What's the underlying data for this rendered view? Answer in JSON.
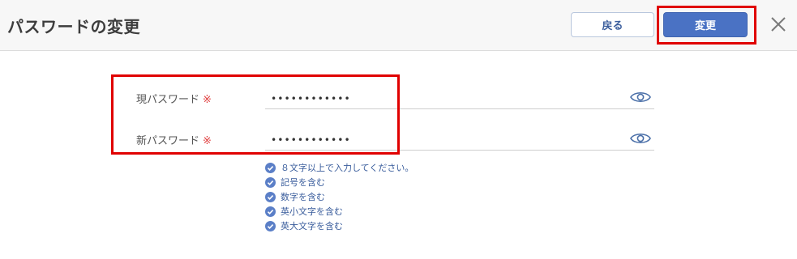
{
  "header": {
    "title": "パスワードの変更",
    "back_label": "戻る",
    "change_label": "変更"
  },
  "form": {
    "current_password": {
      "label": "現パスワード",
      "required_mark": "※",
      "value": "••••••••••••"
    },
    "new_password": {
      "label": "新パスワード",
      "required_mark": "※",
      "value": "••••••••••••"
    }
  },
  "rules": [
    "８文字以上で入力してください。",
    "記号を含む",
    "数字を含む",
    "英小文字を含む",
    "英大文字を含む"
  ],
  "colors": {
    "accent": "#4a72c4",
    "rule_text": "#3a5d9c",
    "required": "#e04040",
    "highlight": "#e00000"
  }
}
